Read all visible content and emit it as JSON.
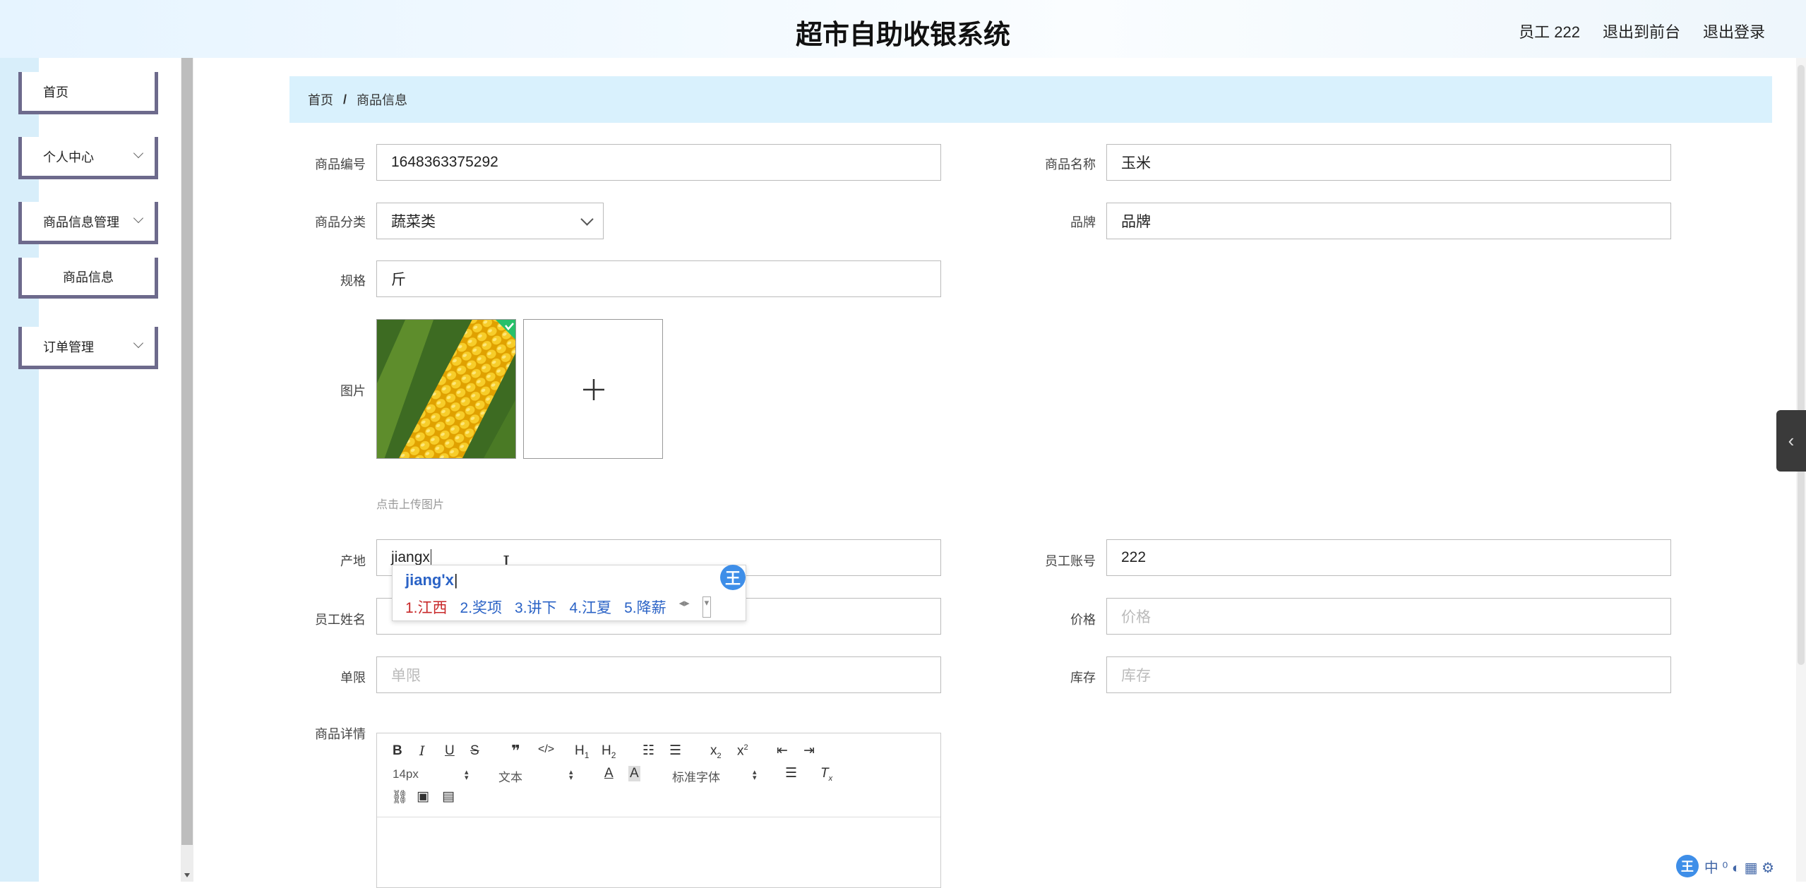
{
  "header": {
    "title": "超市自助收银系统",
    "user": "员工 222",
    "back_front": "退出到前台",
    "logout": "退出登录"
  },
  "sidebar": {
    "items": [
      {
        "label": "首页"
      },
      {
        "label": "个人中心"
      },
      {
        "label": "商品信息管理"
      },
      {
        "label": "商品信息"
      },
      {
        "label": "订单管理"
      }
    ]
  },
  "breadcrumb": {
    "home": "首页",
    "sep": "/",
    "current": "商品信息"
  },
  "form": {
    "code_label": "商品编号",
    "code_value": "1648363375292",
    "name_label": "商品名称",
    "name_value": "玉米",
    "category_label": "商品分类",
    "category_value": "蔬菜类",
    "brand_label": "品牌",
    "brand_value": "品牌",
    "spec_label": "规格",
    "spec_value": "斤",
    "image_label": "图片",
    "upload_hint": "点击上传图片",
    "origin_label": "产地",
    "origin_value": "jiangx",
    "staff_account_label": "员工账号",
    "staff_account_value": "222",
    "staff_name_label": "员工姓名",
    "price_label": "价格",
    "price_placeholder": "价格",
    "limit_label": "单限",
    "limit_placeholder": "单限",
    "stock_label": "库存",
    "stock_placeholder": "库存",
    "detail_label": "商品详情"
  },
  "ime": {
    "pinyin": "jiang'x",
    "badge": "王",
    "candidates": [
      "1.江西",
      "2.奖项",
      "3.讲下",
      "4.江夏",
      "5.降薪"
    ]
  },
  "editor": {
    "font_size": "14px",
    "paragraph": "文本",
    "font_family": "标准字体"
  }
}
